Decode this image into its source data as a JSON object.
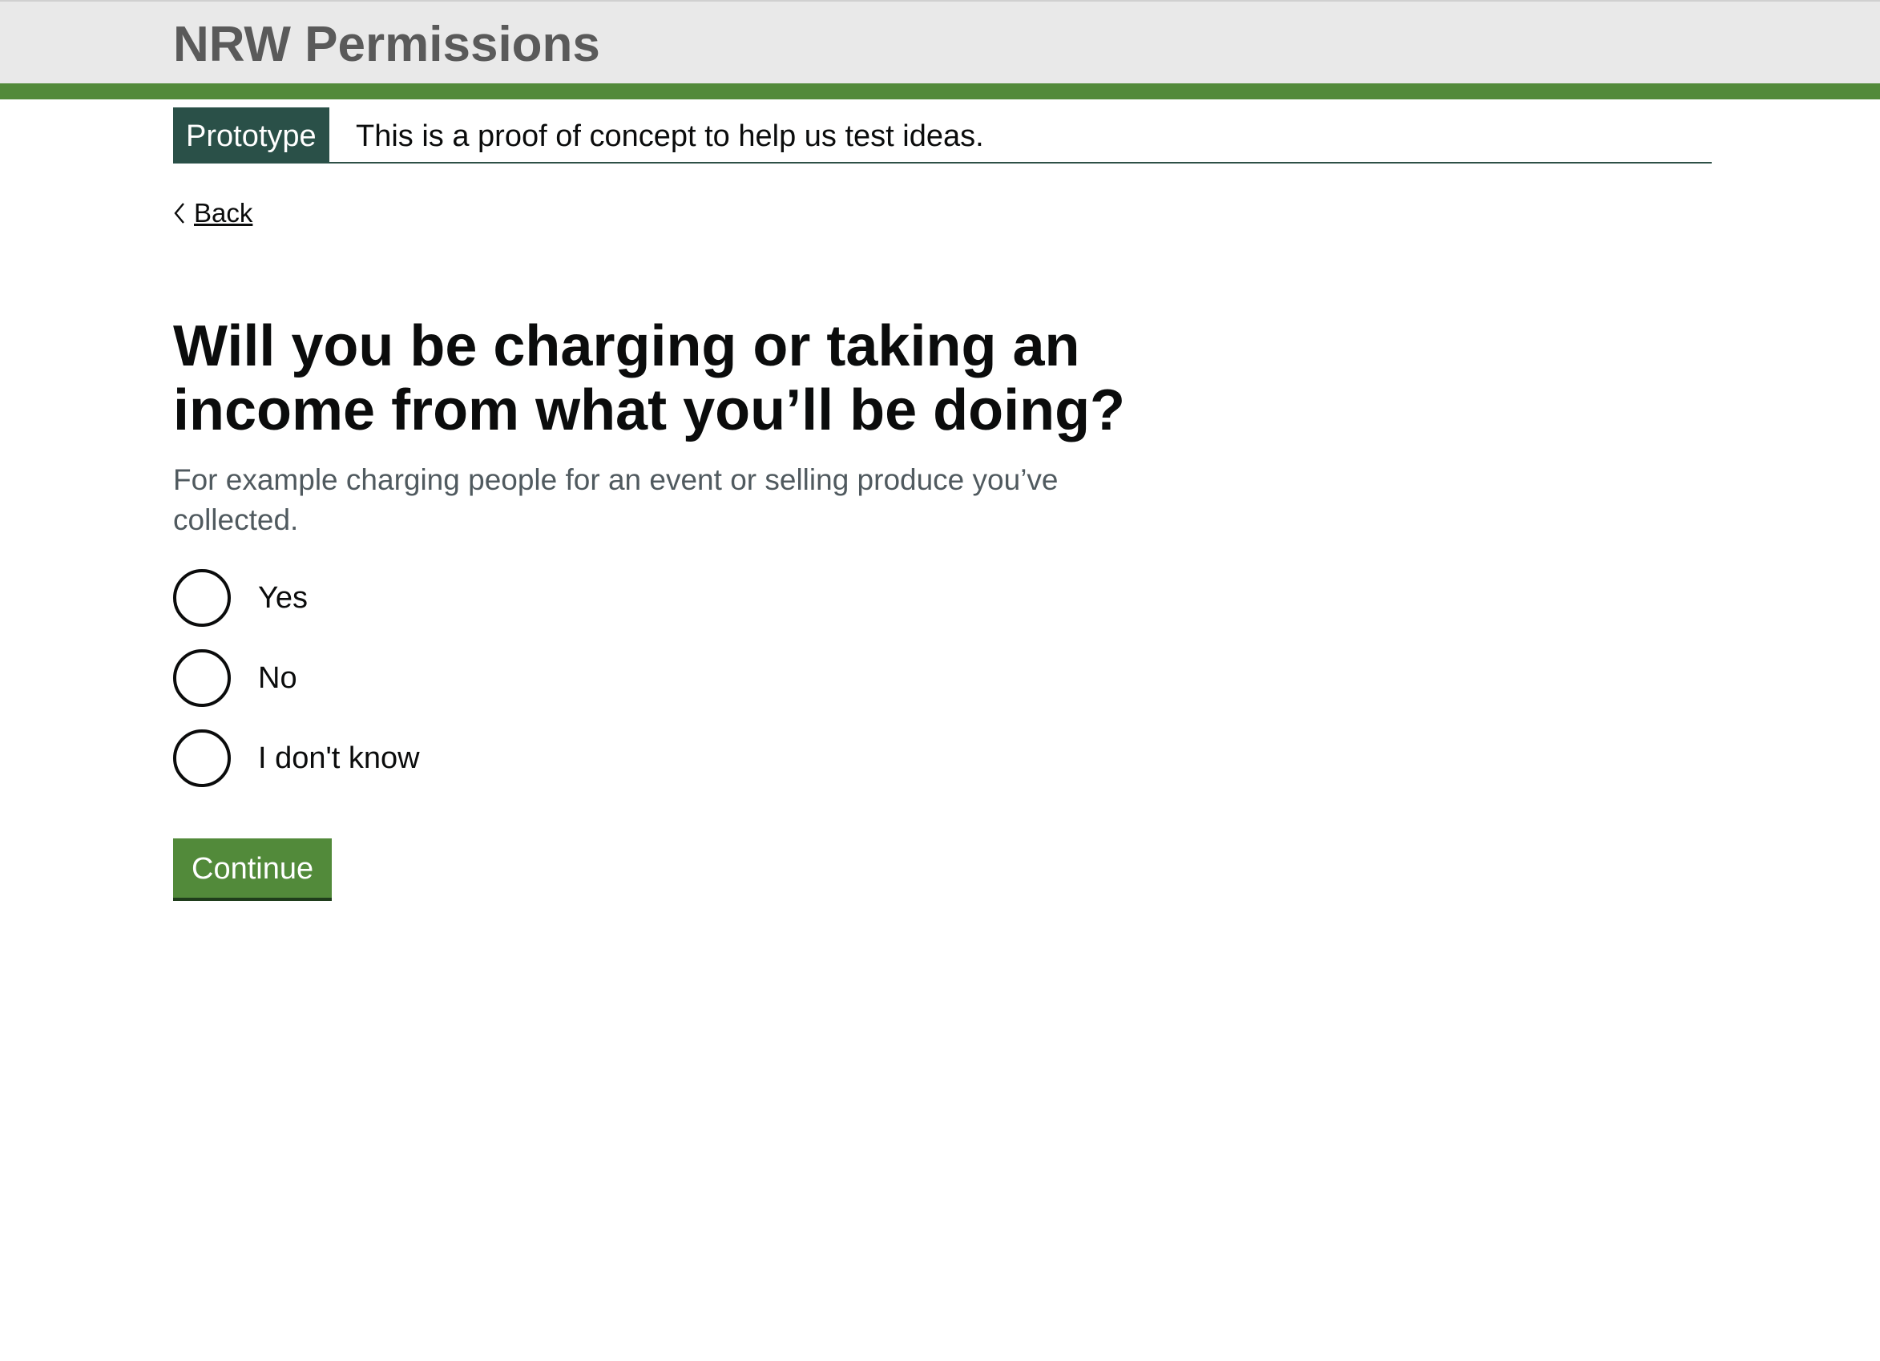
{
  "header": {
    "title": "NRW Permissions"
  },
  "phase_banner": {
    "tag": "Prototype",
    "text": "This is a proof of concept to help us test ideas."
  },
  "back_link": {
    "label": "Back",
    "icon": "chevron-left-icon"
  },
  "question": {
    "heading": "Will you be charging or taking an income from what you’ll be doing?",
    "hint": "For example charging people for an event or selling produce you’ve collected.",
    "options": [
      {
        "label": "Yes",
        "selected": false
      },
      {
        "label": "No",
        "selected": false
      },
      {
        "label": "I don't know",
        "selected": false
      }
    ]
  },
  "actions": {
    "continue_label": "Continue"
  },
  "colors": {
    "brand_green": "#528a3a",
    "phase_tag": "#2a5048",
    "header_background": "#e9e9e9",
    "header_title": "#5a5a5a",
    "hint_text": "#505a5f"
  }
}
